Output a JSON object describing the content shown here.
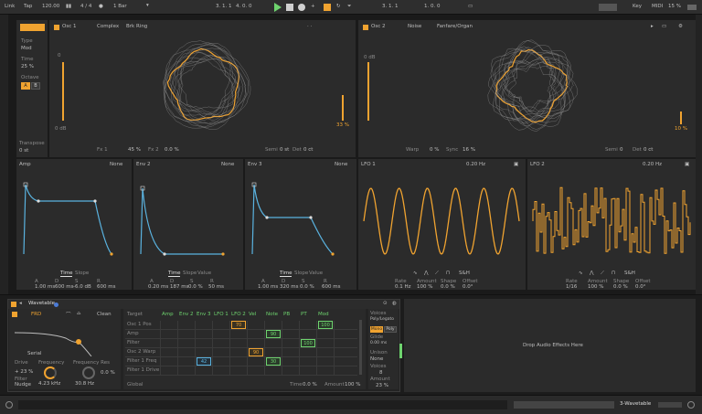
{
  "transport": {
    "link": "Link",
    "tap": "Tap",
    "tempo": "120.00",
    "signature": "4 / 4",
    "metro": "1 Bar",
    "position": "3. 1. 1",
    "loop_len": "4. 0. 0",
    "bar_pos": "3. 1. 1",
    "loop_start": "1. 0. 0",
    "key": "Key",
    "midi": "MIDI",
    "cpu": "15 %"
  },
  "osc1": {
    "title": "Osc 1",
    "category": "Complex",
    "wavetable": "Brk Ring",
    "gain": "Gain",
    "fx1": "Fx 1",
    "fx1_val": "45 %",
    "fx2": "Fx 2",
    "fx2_val": "0.0 %",
    "semi": "Semi",
    "semi_val": "0 st",
    "det": "Det",
    "det_val": "0 ct",
    "pos": "0 dB",
    "pct": "33 %"
  },
  "osc2": {
    "title": "Osc 2",
    "category": "Noise",
    "wavetable": "Fanfare/Organ",
    "gain": "0 dB",
    "pct": "10 %",
    "fx1": "Warp",
    "fx1_val": "0 %",
    "fx2": "Sync",
    "fx2_val": "16 %",
    "semi": "Semi",
    "semi_val": "0",
    "det": "Det",
    "det_val": "0 ct"
  },
  "left_strip": {
    "on": "On",
    "type": "Type",
    "type_val": "Mod",
    "time": "Time",
    "time_val": "25 %",
    "octave": "Octave",
    "oct_a": "A",
    "oct_b": "B",
    "transpose": "Transpose",
    "transpose_val": "0 st"
  },
  "env1": {
    "title": "Amp",
    "mode": "None",
    "tabs": [
      "Time",
      "Slope"
    ],
    "params": [
      "A",
      "D",
      "S",
      "R"
    ],
    "values": [
      "1.00 ms",
      "600 ms",
      "-6.0 dB",
      "600 ms"
    ]
  },
  "env2": {
    "title": "Env 2",
    "mode": "None",
    "tabs": [
      "Time",
      "Slope",
      "Value"
    ],
    "params": [
      "A",
      "D",
      "S",
      "R"
    ],
    "values": [
      "0.20 ms",
      "187 ms",
      "0.0 %",
      "50 ms"
    ]
  },
  "env3": {
    "title": "Env 3",
    "mode": "None",
    "tabs": [
      "Time",
      "Slope",
      "Value"
    ],
    "params": [
      "A",
      "D",
      "S",
      "R"
    ],
    "values": [
      "1.00 ms",
      "320 ms",
      "0.0 %",
      "600 ms"
    ]
  },
  "lfo1": {
    "title": "LFO 1",
    "rate_top": "0.20 Hz",
    "params": [
      "Rate",
      "Amount",
      "Shape",
      "Offset"
    ],
    "values": [
      "0.1 Hz",
      "100 %",
      "0.0 %",
      "0.0°"
    ]
  },
  "lfo2": {
    "title": "LFO 2",
    "rate_top": "0.20 Hz",
    "params": [
      "Rate",
      "Amount",
      "Shape",
      "Offset"
    ],
    "values": [
      "1/16",
      "100 %",
      "0.0 %",
      "0.0°"
    ]
  },
  "device": {
    "name": "Wavetable",
    "filter_type": "FRD",
    "filter_mode": "Clean",
    "serial": "Serial",
    "drive": "Drive",
    "drive_val": "+ 23 %",
    "freq_label": "Frequency",
    "freq_val": "4.23 kHz",
    "res_label": "Frequency Res",
    "res_val": "30.8 Hz",
    "pct": "0.0 %",
    "fmode": "Filter",
    "fmode_val": "Nudge"
  },
  "matrix": {
    "target": "Target",
    "cols": [
      "Amp",
      "Env 2",
      "Env 3",
      "LFO 1",
      "LFO 2",
      "Vel",
      "Note",
      "PB",
      "PT",
      "Mod"
    ],
    "rows": [
      "Osc 1 Pos",
      "Amp",
      "Filter",
      "Osc 2 Warp",
      "Filter 1 Freq",
      "Filter 1 Drive"
    ],
    "cells": [
      {
        "row": 0,
        "col": 4,
        "text": "70",
        "kind": "orange"
      },
      {
        "row": 0,
        "col": 9,
        "text": "100",
        "kind": "green"
      },
      {
        "row": 1,
        "col": 6,
        "text": "90",
        "kind": "green"
      },
      {
        "row": 2,
        "col": 8,
        "text": "100",
        "kind": "green"
      },
      {
        "row": 3,
        "col": 5,
        "text": "90",
        "kind": "orange"
      },
      {
        "row": 4,
        "col": 2,
        "text": "42",
        "kind": "blue"
      },
      {
        "row": 4,
        "col": 6,
        "text": "30",
        "kind": "green"
      }
    ],
    "global": "Global",
    "time": "Time",
    "time_val": "0.0 %",
    "amount": "Amount",
    "amount_val": "100 %"
  },
  "voices": {
    "title": "Voices",
    "mode": "Poly/Legato",
    "mono": "Mono",
    "poly": "Poly",
    "glide": "Glide",
    "glide_val": "0.00 ms",
    "unison": "Unison",
    "unison_val": "None",
    "voices": "Voices",
    "voices_val": "8",
    "amount": "Amount",
    "amount_val": "23 %"
  },
  "drop_zone": "Drop Audio Effects Here",
  "footer": {
    "track": "3-Wavetable"
  },
  "colors": {
    "accent": "#f0a330",
    "env": "#5ab3e0",
    "green": "#6ed36e"
  }
}
